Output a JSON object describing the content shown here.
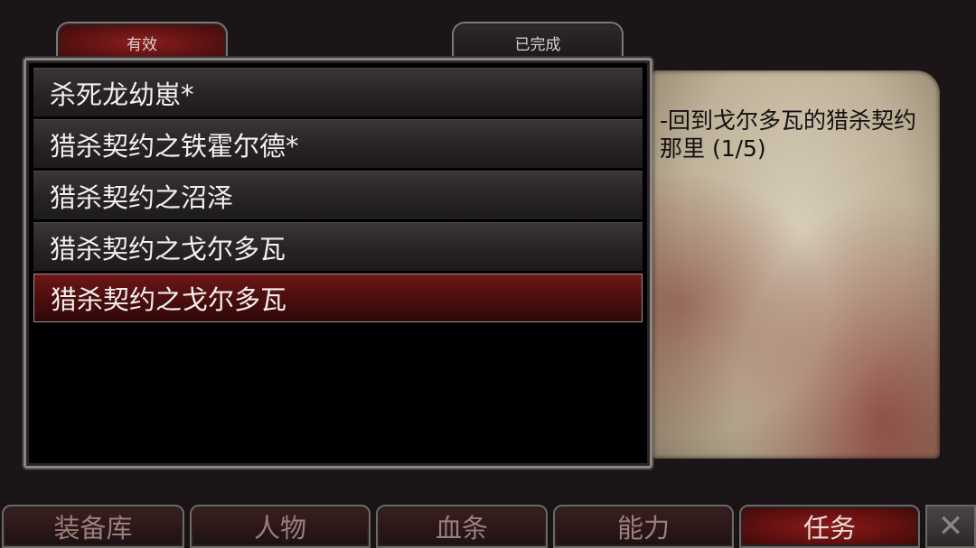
{
  "tabs": {
    "active_label": "有效",
    "completed_label": "已完成"
  },
  "quests": [
    {
      "label": "杀死龙幼崽*"
    },
    {
      "label": "猎杀契约之铁霍尔德*"
    },
    {
      "label": "猎杀契约之沼泽"
    },
    {
      "label": "猎杀契约之戈尔多瓦"
    },
    {
      "label": "猎杀契约之戈尔多瓦"
    }
  ],
  "detail": {
    "text": "-回到戈尔多瓦的猎杀契约那里 (1/5)"
  },
  "nav": {
    "storage": "装备库",
    "character": "人物",
    "health": "血条",
    "abilities": "能力",
    "quests": "任务",
    "close_icon": "✕"
  }
}
